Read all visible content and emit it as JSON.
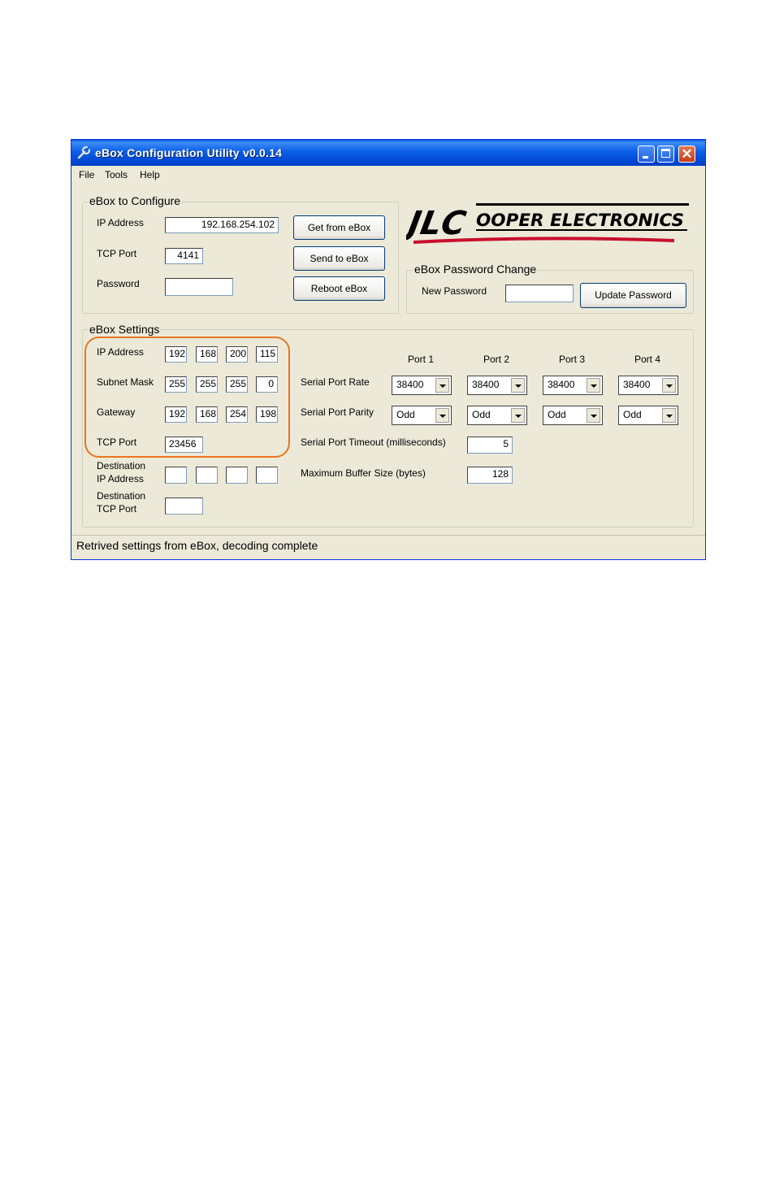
{
  "window": {
    "title": "eBox Configuration Utility v0.0.14",
    "icon": "wrench-icon",
    "controls": {
      "minimize": "minimize-icon",
      "maximize": "maximize-icon",
      "close": "close-icon"
    }
  },
  "menu": [
    "File",
    "Tools",
    "Help"
  ],
  "configure": {
    "title": "eBox to Configure",
    "ip_label": "IP Address",
    "ip_value": "192.168.254.102",
    "port_label": "TCP Port",
    "port_value": "4141",
    "password_label": "Password",
    "password_value": "",
    "buttons": {
      "get": "Get from eBox",
      "send": "Send to eBox",
      "reboot": "Reboot eBox"
    }
  },
  "logo": {
    "letters": "JLC",
    "text": "OOPER ELECTRONICS",
    "colors": {
      "primary": "#000000",
      "accent": "#c8102e"
    }
  },
  "password_change": {
    "title": "eBox Password Change",
    "new_label": "New Password",
    "new_value": "",
    "update_button": "Update Password"
  },
  "settings": {
    "title": "eBox Settings",
    "ip_label": "IP Address",
    "ip": [
      "192",
      "168",
      "200",
      "115"
    ],
    "subnet_label": "Subnet Mask",
    "subnet": [
      "255",
      "255",
      "255",
      "0"
    ],
    "gateway_label": "Gateway",
    "gateway": [
      "192",
      "168",
      "254",
      "198"
    ],
    "tcp_label": "TCP Port",
    "tcp_value": "23456",
    "dest_ip_label_1": "Destination",
    "dest_ip_label_2": "IP Address",
    "dest_ip": [
      "",
      "",
      "",
      ""
    ],
    "dest_port_label_1": "Destination",
    "dest_port_label_2": "TCP Port",
    "dest_port_value": "",
    "ports": [
      "Port 1",
      "Port 2",
      "Port 3",
      "Port 4"
    ],
    "rate_label": "Serial Port Rate",
    "rates": [
      "38400",
      "38400",
      "38400",
      "38400"
    ],
    "parity_label": "Serial Port Parity",
    "parities": [
      "Odd",
      "Odd",
      "Odd",
      "Odd"
    ],
    "timeout_label": "Serial Port Timeout (milliseconds)",
    "timeout_value": "5",
    "buffer_label": "Maximum Buffer Size (bytes)",
    "buffer_value": "128",
    "highlight_color": "#e8751f"
  },
  "status": "Retrived settings from eBox, decoding complete"
}
